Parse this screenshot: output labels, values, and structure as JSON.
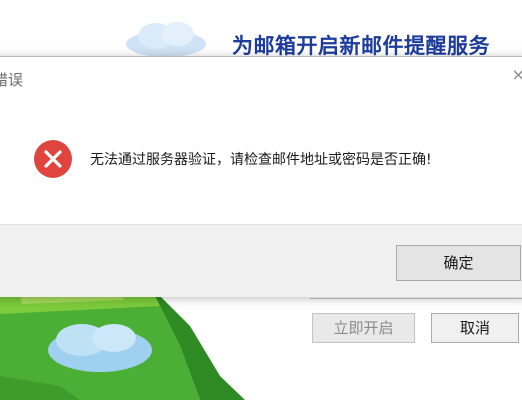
{
  "background_window": {
    "title": "为邮箱开启新邮件提醒服务",
    "buttons": {
      "enable_now": "立即开启",
      "cancel": "取消"
    }
  },
  "dialog": {
    "title": "错误",
    "close_glyph": "×",
    "icon": "error-icon",
    "message": "无法通过服务器验证，请检查邮件地址或密码是否正确!",
    "ok_label": "确定"
  },
  "colors": {
    "title_blue": "#1d3c9c",
    "error_red": "#e0443e",
    "footer_gray": "#f0f0f0"
  }
}
